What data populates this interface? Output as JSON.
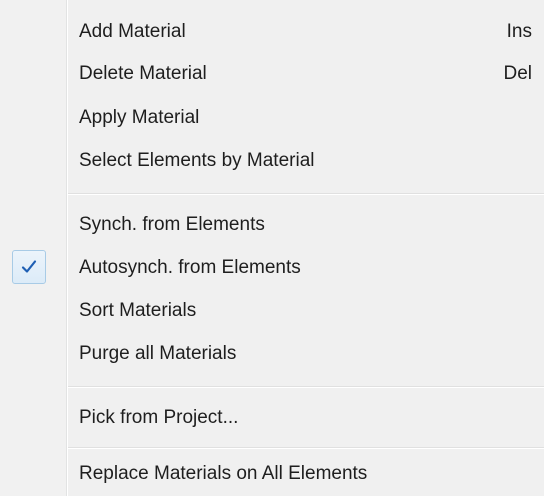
{
  "menu": {
    "items": [
      {
        "label": "Add Material",
        "shortcut": "Ins"
      },
      {
        "label": "Delete Material",
        "shortcut": "Del"
      },
      {
        "label": "Apply Material"
      },
      {
        "label": "Select Elements by Material"
      },
      {
        "label": "Synch. from Elements"
      },
      {
        "label": "Autosynch. from Elements",
        "checked": true
      },
      {
        "label": "Sort Materials"
      },
      {
        "label": "Purge all Materials"
      },
      {
        "label": "Pick from Project..."
      },
      {
        "label": "Replace Materials on All Elements"
      }
    ]
  },
  "colors": {
    "background": "#f0f0f0",
    "check_mark": "#1f5fb4",
    "check_highlight_border": "#a8cbe6"
  },
  "icons": {
    "check": "check-icon"
  }
}
